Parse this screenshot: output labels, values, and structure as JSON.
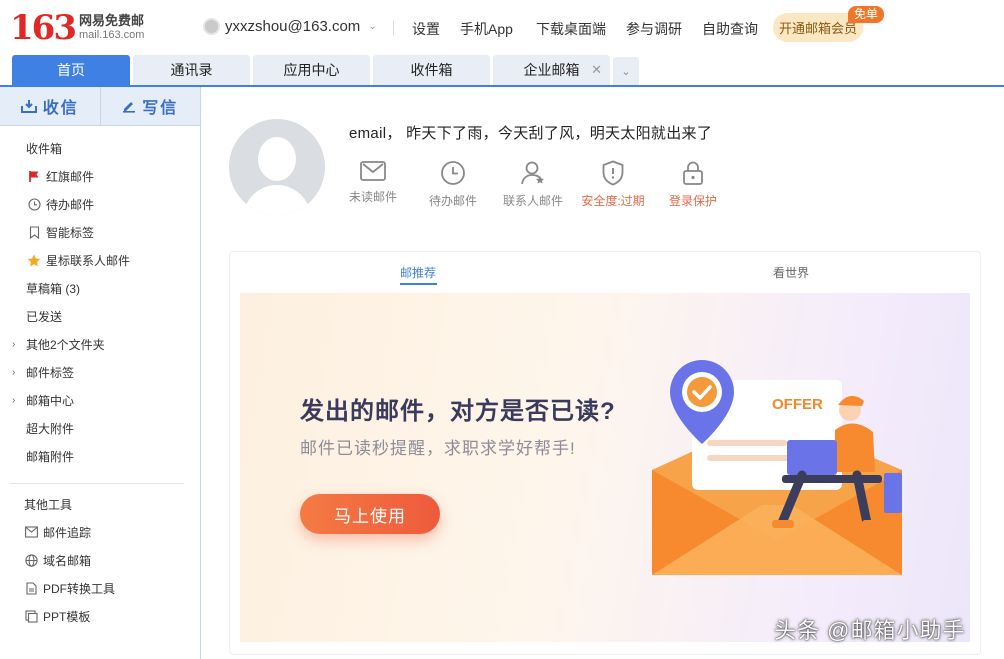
{
  "header": {
    "logo_number": "163",
    "logo_cn": "网易免费邮",
    "logo_domain": "mail.163.com",
    "account": "yxxzshou@163.com",
    "nav": [
      "设置",
      "手机App",
      "下载桌面端",
      "参与调研",
      "自助查询"
    ],
    "vip_button": "开通邮箱会员",
    "vip_badge": "免单"
  },
  "tabs": [
    {
      "label": "首页",
      "active": true
    },
    {
      "label": "通讯录"
    },
    {
      "label": "应用中心"
    },
    {
      "label": "收件箱"
    },
    {
      "label": "企业邮箱",
      "closable": true
    }
  ],
  "sidebar": {
    "receive": "收信",
    "compose": "写信",
    "items": [
      {
        "label": "收件箱"
      },
      {
        "label": "红旗邮件",
        "icon": "flag-icon"
      },
      {
        "label": "待办邮件",
        "icon": "clock-icon"
      },
      {
        "label": "智能标签",
        "icon": "bookmark-icon"
      },
      {
        "label": "星标联系人邮件",
        "icon": "star-icon"
      },
      {
        "label": "草稿箱 (3)"
      },
      {
        "label": "已发送"
      },
      {
        "label": "其他2个文件夹",
        "collapsible": true
      },
      {
        "label": "邮件标签",
        "collapsible": true
      },
      {
        "label": "邮箱中心",
        "collapsible": true
      },
      {
        "label": "超大附件"
      },
      {
        "label": "邮箱附件"
      }
    ],
    "tools_title": "其他工具",
    "tools": [
      {
        "label": "邮件追踪",
        "icon": "mail-track-icon"
      },
      {
        "label": "域名邮箱",
        "icon": "globe-icon"
      },
      {
        "label": "PDF转换工具",
        "icon": "pdf-icon"
      },
      {
        "label": "PPT模板",
        "icon": "ppt-icon"
      }
    ]
  },
  "main": {
    "greeting": "email，  昨天下了雨，今天刮了风，明天太阳就出来了",
    "quick": [
      {
        "label": "未读邮件",
        "icon": "envelope-icon"
      },
      {
        "label": "待办邮件",
        "icon": "clock-icon"
      },
      {
        "label": "联系人邮件",
        "icon": "contact-icon"
      },
      {
        "label": "安全度:过期",
        "icon": "shield-icon",
        "warn": true
      },
      {
        "label": "登录保护",
        "icon": "lock-icon",
        "warn": true
      }
    ],
    "card_tabs": [
      "邮推荐",
      "看世界"
    ],
    "banner": {
      "title": "发出的邮件，对方是否已读?",
      "subtitle": "邮件已读秒提醒，求职求学好帮手!",
      "button": "马上使用",
      "offer": "OFFER"
    }
  },
  "watermark": "头条 @邮箱小助手",
  "colors": {
    "brand_red": "#e02826",
    "accent_blue": "#3e80e4",
    "warn_orange": "#e56a4a"
  }
}
